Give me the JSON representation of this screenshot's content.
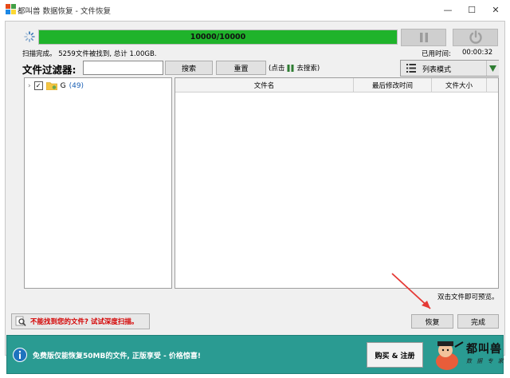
{
  "window": {
    "title": "都叫兽 数据恢复 - 文件恢复",
    "minimize_glyph": "—",
    "maximize_glyph": "☐",
    "close_glyph": "✕"
  },
  "progress": {
    "text": "10000/10000",
    "fraction": 1.0,
    "fill_color": "#1fb32b"
  },
  "controls": {
    "pause_icon": "pause-icon",
    "stop_icon": "stop-icon"
  },
  "status": {
    "scan_text": "扫描完成。 5259文件被找到, 总计 1.00GB.",
    "elapsed_label": "已用时间:",
    "elapsed_value": "00:00:32"
  },
  "filter": {
    "label": "文件过滤器:",
    "value": "",
    "search_label": "搜索",
    "reset_label": "重置",
    "hint_prefix": "(点击",
    "hint_suffix": "去搜索)"
  },
  "view_mode": {
    "label": "列表模式"
  },
  "tree": {
    "drive": "G",
    "count": "(49)",
    "checked_glyph": "✓"
  },
  "list": {
    "columns": [
      "文件名",
      "最后修改时间",
      "文件大小"
    ]
  },
  "preview_hint": "双击文件即可预览。",
  "bottom": {
    "deep_scan_label": "不能找到您的文件? 试试深度扫描。",
    "recover_label": "恢复",
    "finish_label": "完成"
  },
  "promo": {
    "text": "免费版仅能恢复50MB的文件, 正版享受 - 价格惊喜!",
    "buy_label": "购买 & 注册",
    "logo_text": "都叫兽",
    "logo_sub": "数 据 专 家",
    "bg_color": "#2a9b92"
  }
}
